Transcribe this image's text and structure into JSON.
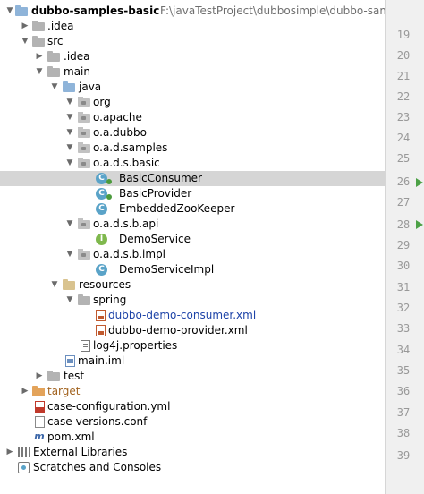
{
  "project": {
    "name": "dubbo-samples-basic",
    "path": "F:\\javaTestProject\\dubbosimple\\dubbo-samples\\dubbo-s"
  },
  "tree": {
    "idea": ".idea",
    "src": "src",
    "src_idea": ".idea",
    "main": "main",
    "java": "java",
    "org": "org",
    "o_apache": "o.apache",
    "o_a_dubbo": "o.a.dubbo",
    "o_a_d_samples": "o.a.d.samples",
    "o_a_d_s_basic": "o.a.d.s.basic",
    "basic_consumer": "BasicConsumer",
    "basic_provider": "BasicProvider",
    "embedded_zookeeper": "EmbeddedZooKeeper",
    "o_a_d_s_b_api": "o.a.d.s.b.api",
    "demo_service": "DemoService",
    "o_a_d_s_b_impl": "o.a.d.s.b.impl",
    "demo_service_impl": "DemoServiceImpl",
    "resources": "resources",
    "spring": "spring",
    "consumer_xml": "dubbo-demo-consumer.xml",
    "provider_xml": "dubbo-demo-provider.xml",
    "log4j": "log4j.properties",
    "main_iml": "main.iml",
    "test": "test",
    "target": "target",
    "case_configuration": "case-configuration.yml",
    "case_versions": "case-versions.conf",
    "pom": "pom.xml",
    "external_libraries": "External Libraries",
    "scratches": "Scratches and Consoles"
  },
  "class_icon_letter": "C",
  "interface_icon_letter": "I",
  "maven_icon_letter": "m",
  "gutter": {
    "line_numbers": [
      "19",
      "20",
      "21",
      "22",
      "23",
      "24",
      "25",
      "26",
      "27",
      "28",
      "29",
      "30",
      "31",
      "32",
      "33",
      "34",
      "35",
      "36",
      "37",
      "38",
      "39"
    ]
  },
  "colors": {
    "selection": "#d5d5d5",
    "run_marker": "#4ca146",
    "target_folder": "#a2631f",
    "xml_highlight": "#1d43a8"
  }
}
